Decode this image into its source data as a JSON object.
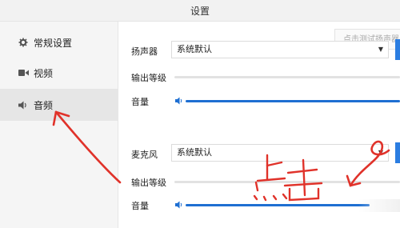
{
  "window": {
    "title": "设置"
  },
  "sidebar": {
    "items": [
      {
        "label": "常规设置",
        "icon": "gear-icon"
      },
      {
        "label": "视频",
        "icon": "video-camera-icon"
      },
      {
        "label": "音频",
        "icon": "speaker-icon"
      }
    ],
    "selected": "音频"
  },
  "speaker_section": {
    "label": "扬声器",
    "device_value": "系统默认",
    "output_level_label": "输出等级",
    "volume_label": "音量",
    "volume_level_pct": 100,
    "test_hint": "点击测试扬声器"
  },
  "mic_section": {
    "label": "麦克风",
    "device_value": "系统默认",
    "output_level_label": "输出等级",
    "volume_label": "音量",
    "volume_level_pct": 100
  },
  "annotation": {
    "handwritten_text": "点击",
    "color": "#e0322a"
  },
  "colors": {
    "accent": "#1e6fd2",
    "annotation": "#e0322a"
  }
}
